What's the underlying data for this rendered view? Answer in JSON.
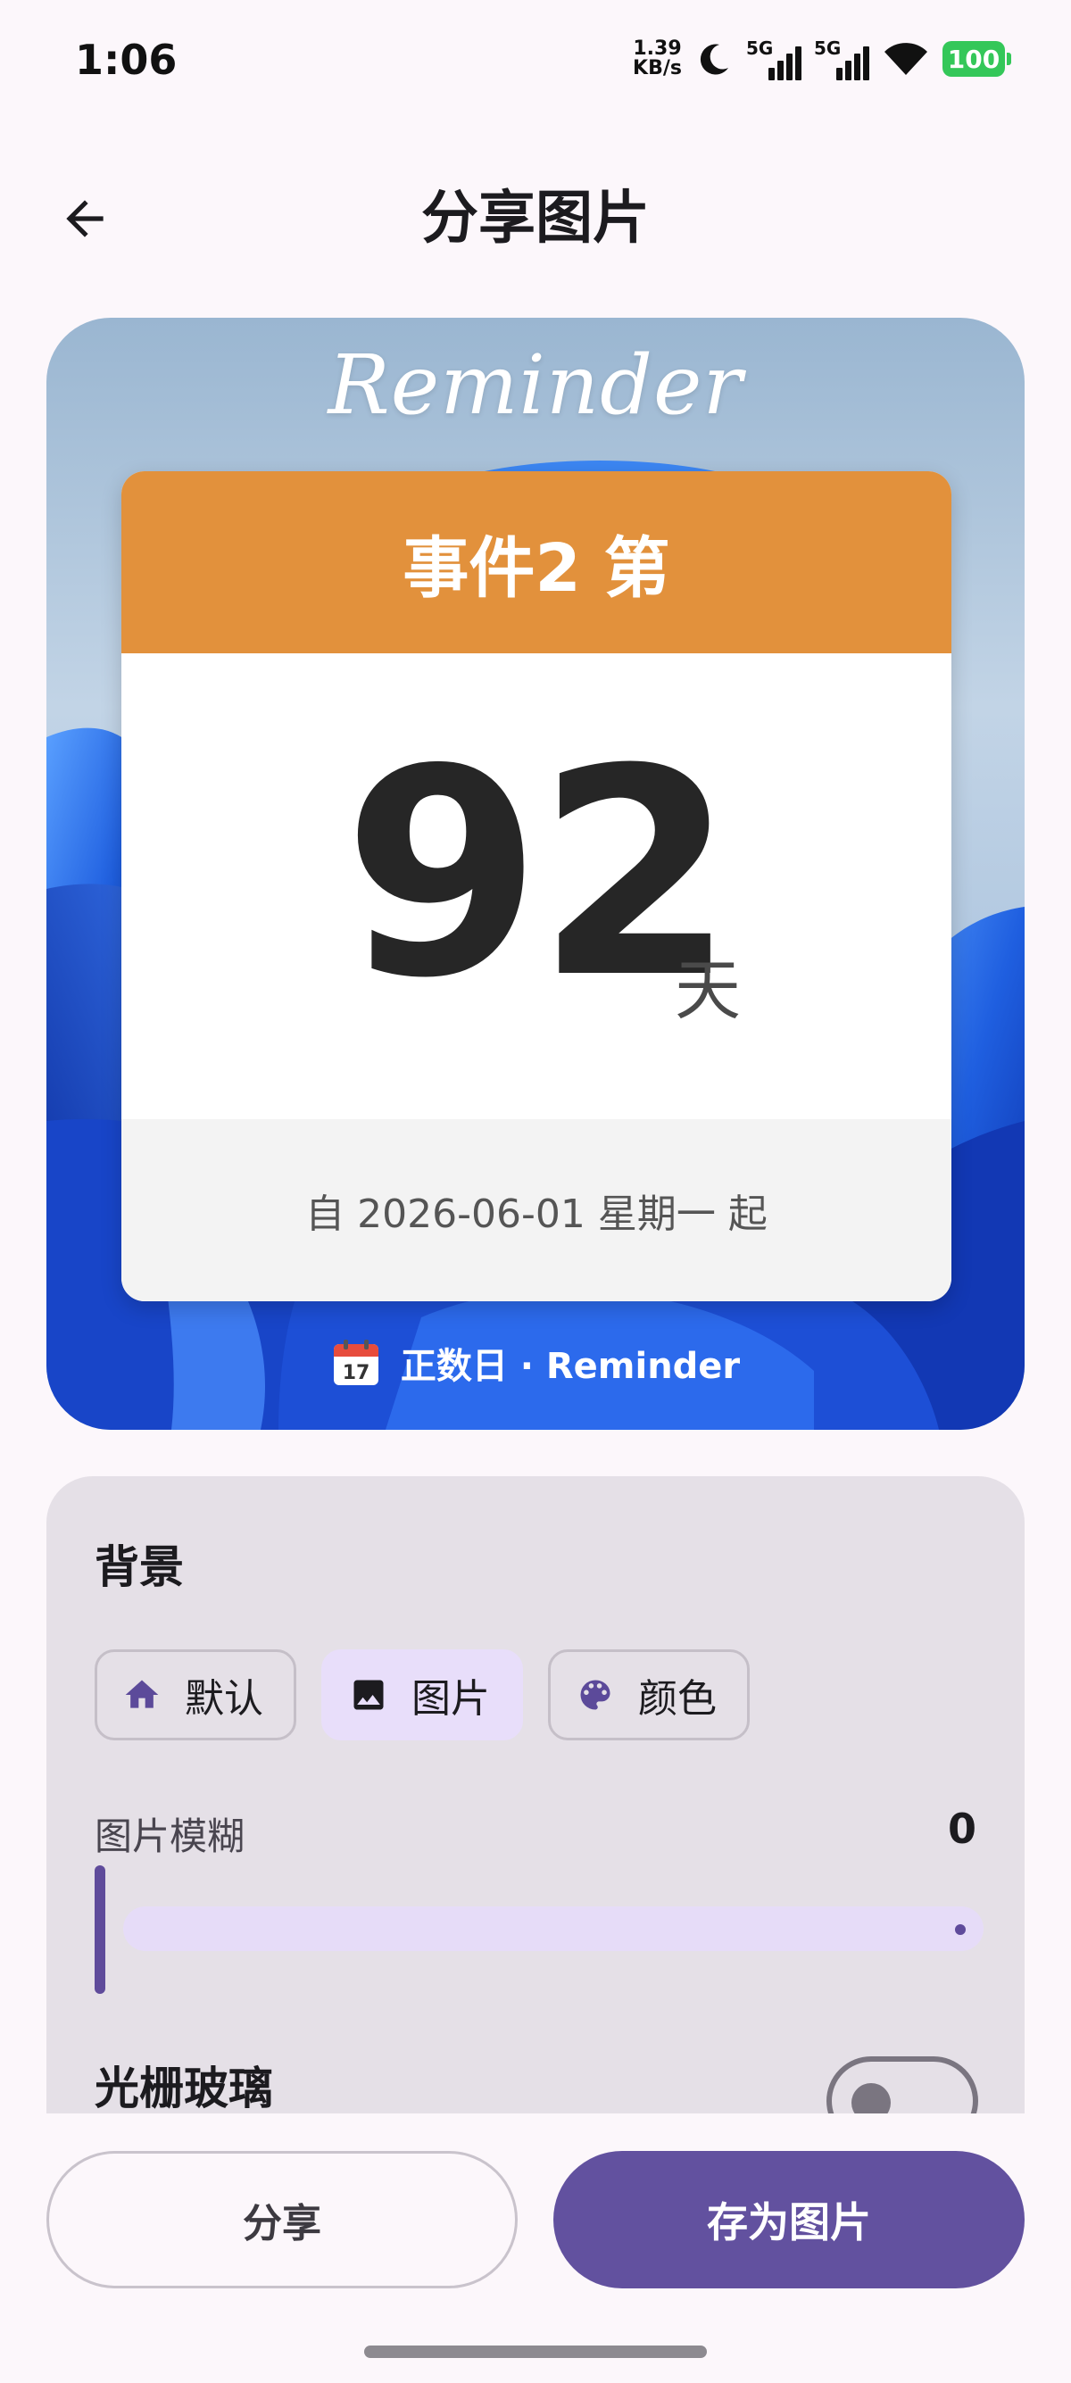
{
  "status_bar": {
    "time": "1:06",
    "net_speed_value": "1.39",
    "net_speed_unit": "KB/s",
    "sim1_label": "5G",
    "sim2_label": "5G",
    "battery": "100",
    "icons": [
      "moon-icon",
      "signal-icon",
      "signal-icon",
      "wifi-icon",
      "battery-icon"
    ]
  },
  "app_bar": {
    "title": "分享图片",
    "back_icon": "arrow-left-icon"
  },
  "preview": {
    "brand": "Reminder",
    "event_title": "事件2 第",
    "days": "92",
    "days_unit": "天",
    "since_text": "自 2026-06-01 星期一 起",
    "caption": "正数日 · Reminder",
    "calendar_day": "17",
    "header_color": "#e2913c"
  },
  "settings": {
    "background_title": "背景",
    "options": [
      {
        "label": "默认",
        "icon": "home-icon",
        "selected": false
      },
      {
        "label": "图片",
        "icon": "image-icon",
        "selected": true
      },
      {
        "label": "颜色",
        "icon": "palette-icon",
        "selected": false
      }
    ],
    "blur_label": "图片模糊",
    "blur_value": "0",
    "glass_label": "光栅玻璃",
    "glass_enabled": false
  },
  "actions": {
    "share_label": "分享",
    "save_label": "存为图片",
    "accent_color": "#62519f"
  }
}
